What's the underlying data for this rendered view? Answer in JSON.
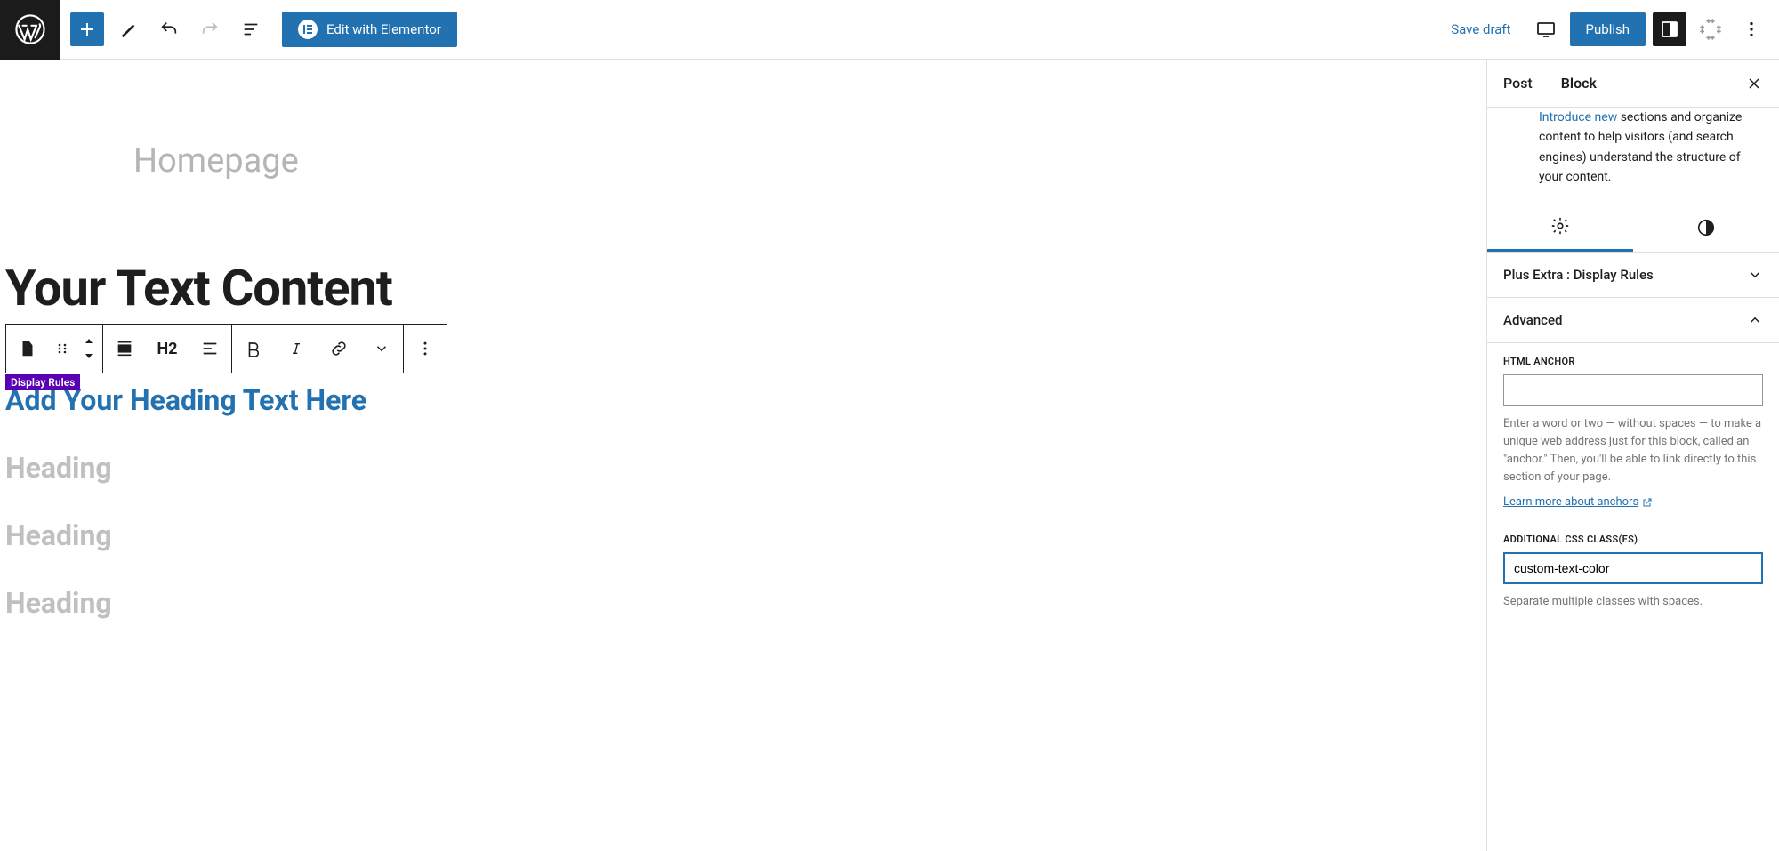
{
  "topbar": {
    "edit_elementor": "Edit with Elementor",
    "save_draft": "Save draft",
    "publish": "Publish"
  },
  "editor": {
    "page_title": "Homepage",
    "content_top": "Your Text Content",
    "rules_tag": "Display Rules",
    "selected_heading": "Add Your Heading Text Here",
    "heading_1": "Heading",
    "heading_2": "Heading",
    "heading_3": "Heading",
    "h2_label": "H2"
  },
  "sidebar": {
    "tab_post": "Post",
    "tab_block": "Block",
    "desc_prefix": "Introduce new",
    "desc_rest": " sections and organize content to help visitors (and search engines) understand the structure of your content.",
    "panel_display_rules": "Plus Extra : Display Rules",
    "panel_advanced": "Advanced",
    "anchor_label": "HTML ANCHOR",
    "anchor_value": "",
    "anchor_help": "Enter a word or two — without spaces — to make a unique web address just for this block, called an \"anchor.\" Then, you'll be able to link directly to this section of your page.",
    "anchor_link": "Learn more about anchors",
    "css_label": "ADDITIONAL CSS CLASS(ES)",
    "css_value": "custom-text-color",
    "css_help": "Separate multiple classes with spaces."
  }
}
